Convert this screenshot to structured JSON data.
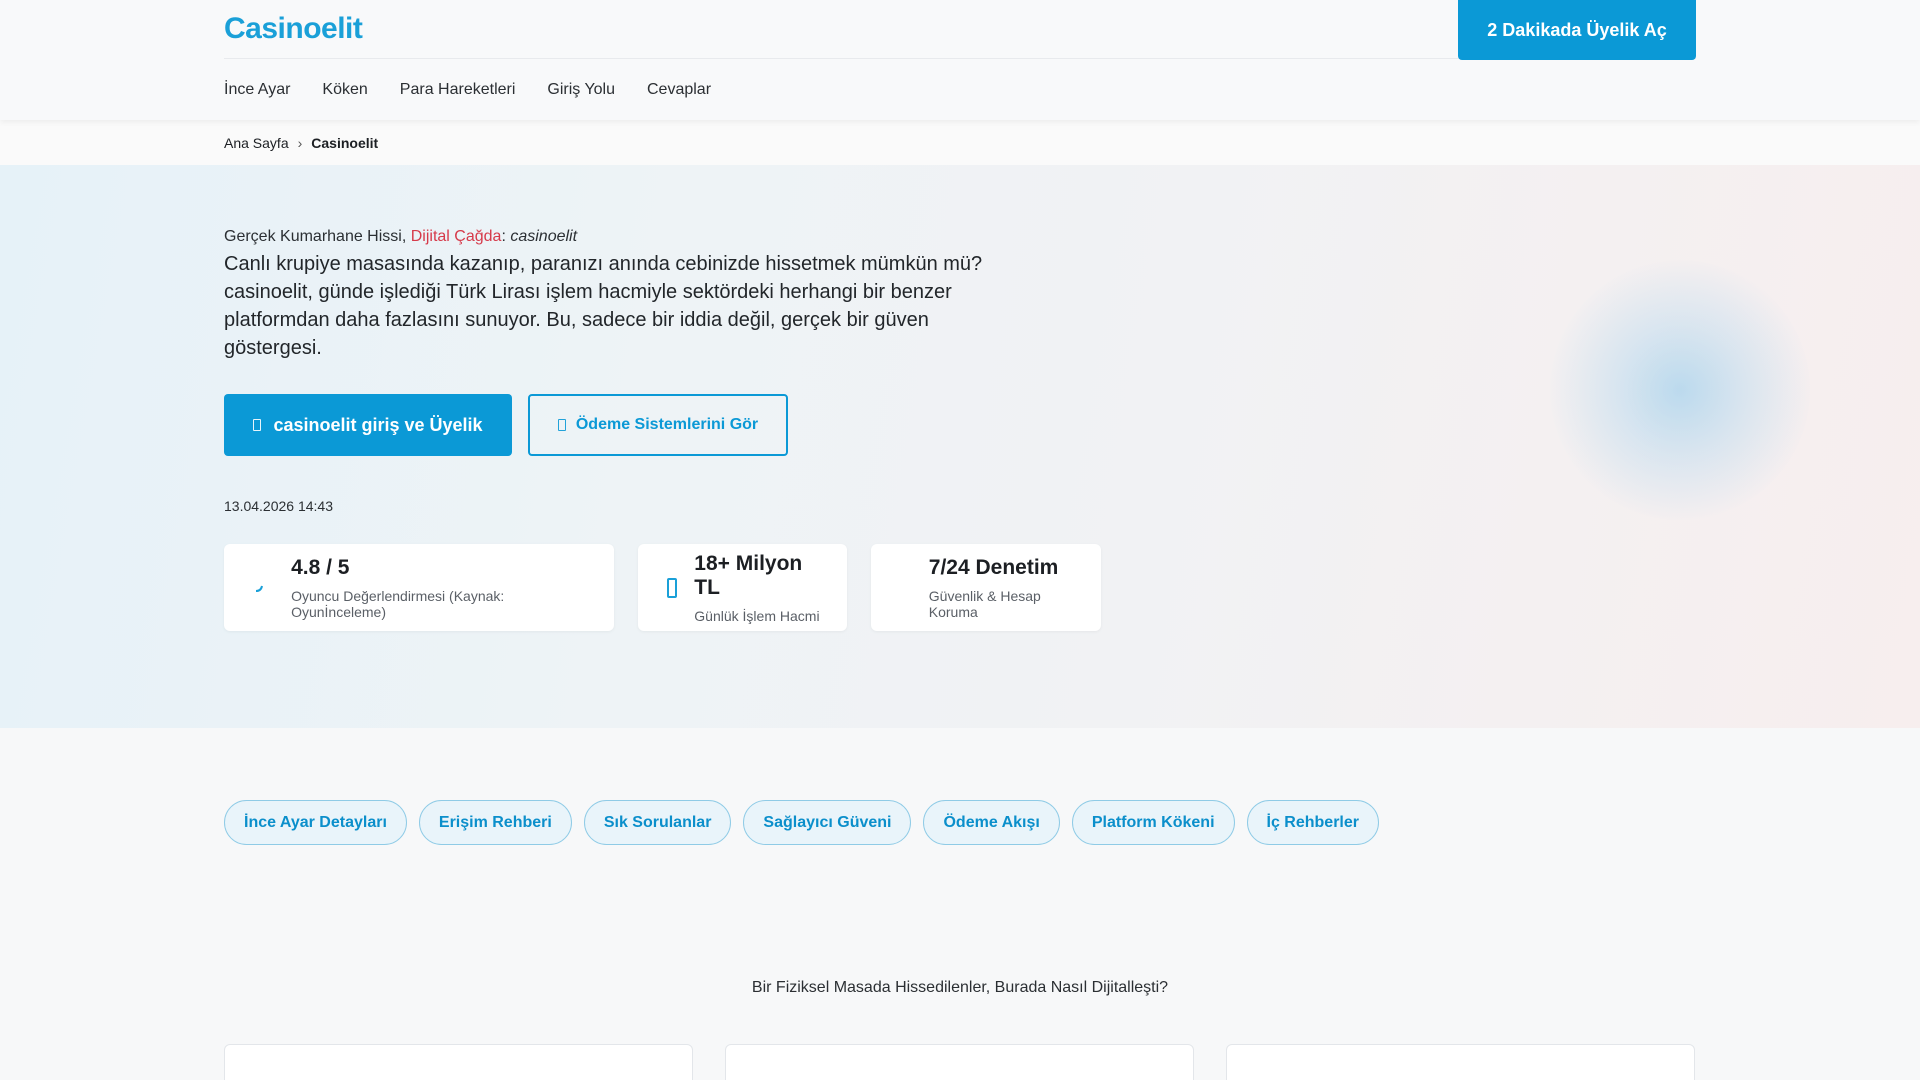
{
  "header": {
    "logo": "Casinoelit",
    "cta": "2 Dakikada Üyelik Aç",
    "nav": [
      "İnce Ayar",
      "Köken",
      "Para Hareketleri",
      "Giriş Yolu",
      "Cevaplar"
    ]
  },
  "breadcrumb": {
    "home": "Ana Sayfa",
    "separator": "›",
    "current": "Casinoelit"
  },
  "hero": {
    "eyebrow_a": "Gerçek Kumarhane Hissi, ",
    "eyebrow_accent": "Dijital Çağda",
    "eyebrow_colon": ": ",
    "eyebrow_em": "casinoelit",
    "lead": "Canlı krupiye masasında kazanıp, paranızı anında cebinizde hissetmek mümkün mü? casinoelit, günde işlediği Türk Lirası işlem hacmiyle sektördeki herhangi bir benzer platformdan daha fazlasını sunuyor. Bu, sadece bir iddia değil, gerçek bir güven göstergesi.",
    "primary_button": "casinoelit giriş ve Üyelik",
    "outline_button": "Ödeme Sistemlerini Gör",
    "date": "13.04.2026 14:43",
    "stats": [
      {
        "value": "4.8 / 5",
        "label": "Oyuncu Değerlendirmesi (Kaynak: Oyunİnceleme)",
        "icon": "rating-icon"
      },
      {
        "value": "18+ Milyon TL",
        "label": "Günlük İşlem Hacmi",
        "icon": "money-icon"
      },
      {
        "value": "7/24 Denetim",
        "label": "Güvenlik & Hesap Koruma",
        "icon": "shield-icon"
      }
    ]
  },
  "pills": [
    "İnce Ayar Detayları",
    "Erişim Rehberi",
    "Sık Sorulanlar",
    "Sağlayıcı Güveni",
    "Ödeme Akışı",
    "Platform Kökeni",
    "İç Rehberler"
  ],
  "section": {
    "question": "Bir Fiziksel Masada Hissedilenler, Burada Nasıl Dijitalleşti?"
  },
  "colors": {
    "accent": "#0b99d6",
    "highlight": "#d63a4a"
  }
}
